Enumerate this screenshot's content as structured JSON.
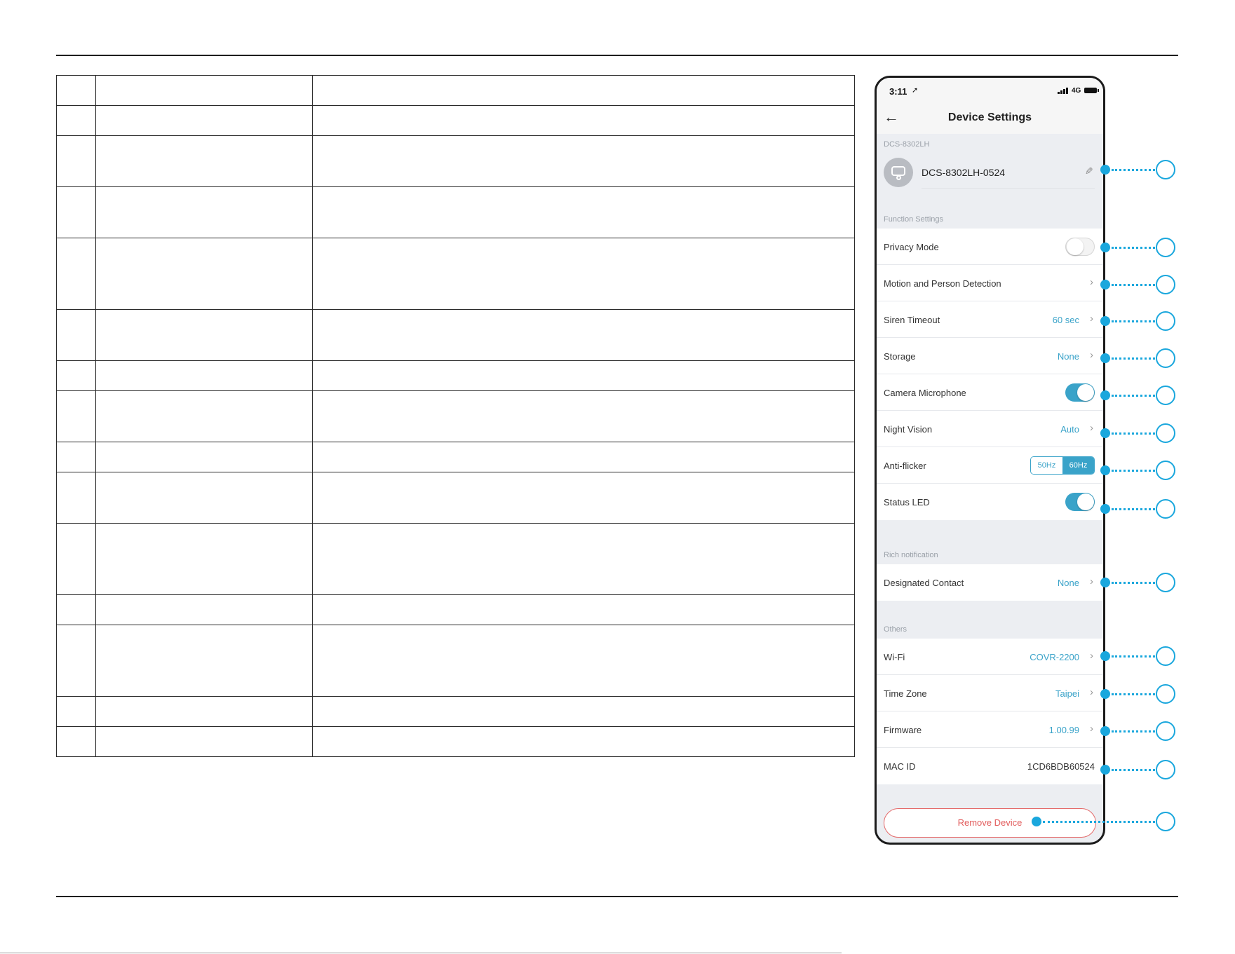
{
  "phone": {
    "status_bar": {
      "time": "3:11",
      "network": "4G"
    },
    "header": {
      "title": "Device Settings"
    },
    "device": {
      "section_label": "DCS-8302LH",
      "name": "DCS-8302LH-0524"
    },
    "function_settings": {
      "section_label": "Function Settings",
      "privacy_mode": {
        "label": "Privacy Mode",
        "enabled": false
      },
      "motion_detection": {
        "label": "Motion and Person Detection"
      },
      "siren_timeout": {
        "label": "Siren Timeout",
        "value": "60 sec"
      },
      "storage": {
        "label": "Storage",
        "value": "None"
      },
      "camera_microphone": {
        "label": "Camera Microphone",
        "enabled": true
      },
      "night_vision": {
        "label": "Night Vision",
        "value": "Auto"
      },
      "anti_flicker": {
        "label": "Anti-flicker",
        "options": [
          "50Hz",
          "60Hz"
        ],
        "selected": "60Hz"
      },
      "status_led": {
        "label": "Status LED",
        "enabled": true
      }
    },
    "rich_notification": {
      "section_label": "Rich notification",
      "designated_contact": {
        "label": "Designated Contact",
        "value": "None"
      }
    },
    "others": {
      "section_label": "Others",
      "wifi": {
        "label": "Wi-Fi",
        "value": "COVR-2200"
      },
      "time_zone": {
        "label": "Time Zone",
        "value": "Taipei"
      },
      "firmware": {
        "label": "Firmware",
        "value": "1.00.99"
      },
      "mac_id": {
        "label": "MAC ID",
        "value": "1CD6BDB60524"
      }
    },
    "remove_button": {
      "label": "Remove Device"
    }
  },
  "colors": {
    "accent": "#3aa3c9",
    "callout": "#1aa7dd",
    "danger": "#e25c5c"
  },
  "icons": [
    "location-arrow-icon",
    "signal-icon",
    "battery-icon",
    "back-arrow-icon",
    "camera-icon",
    "pencil-icon",
    "chevron-right-icon"
  ]
}
